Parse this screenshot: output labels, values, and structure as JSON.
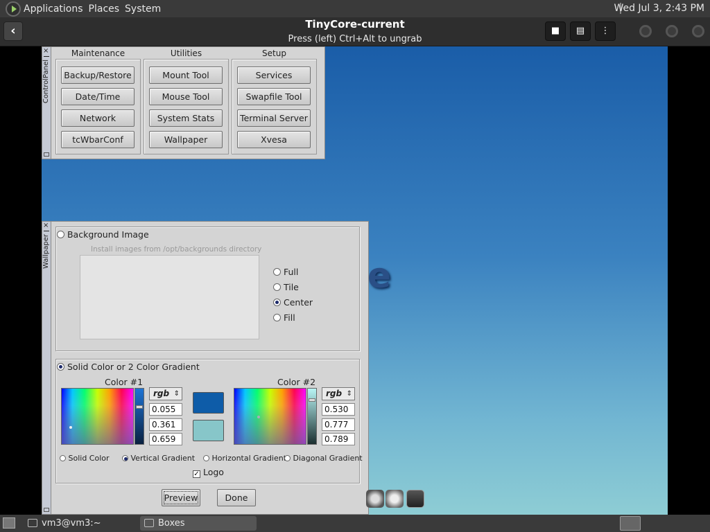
{
  "top_panel": {
    "menus": [
      "Applications",
      "Places",
      "System"
    ],
    "clock": "Wed Jul  3,  2:43 PM"
  },
  "header": {
    "title": "TinyCore-current",
    "subtitle": "Press (left) Ctrl+Alt to ungrab",
    "back_icon": "back-arrow-icon",
    "buttons": [
      "stop-icon",
      "screenshot-icon",
      "menu-icon"
    ]
  },
  "control_panel": {
    "window_title": "ControlPanel",
    "groups": [
      {
        "heading": "Maintenance",
        "buttons": [
          "Backup/Restore",
          "Date/Time",
          "Network",
          "tcWbarConf"
        ]
      },
      {
        "heading": "Utilities",
        "buttons": [
          "Mount Tool",
          "Mouse Tool",
          "System Stats",
          "Wallpaper"
        ]
      },
      {
        "heading": "Setup",
        "buttons": [
          "Services",
          "Swapfile Tool",
          "Terminal Server",
          "Xvesa"
        ]
      }
    ]
  },
  "wallpaper": {
    "window_title": "Wallpaper",
    "bg_image_label": "Background Image",
    "bg_image_hint": "Install images from /opt/backgrounds directory",
    "placement": [
      {
        "label": "Full",
        "selected": false
      },
      {
        "label": "Tile",
        "selected": false
      },
      {
        "label": "Center",
        "selected": true
      },
      {
        "label": "Fill",
        "selected": false
      }
    ],
    "solid_label": "Solid Color or 2 Color Gradient",
    "color1": {
      "label": "Color #1",
      "mode": "rgb",
      "values": [
        "0.055",
        "0.361",
        "0.659"
      ],
      "hex": "#0e5ca8"
    },
    "color2": {
      "label": "Color #2",
      "mode": "rgb",
      "values": [
        "0.530",
        "0.777",
        "0.789"
      ],
      "hex": "#87c6c9"
    },
    "gradient_types": [
      {
        "label": "Solid Color",
        "selected": false
      },
      {
        "label": "Vertical Gradient",
        "selected": true
      },
      {
        "label": "Horizontal Gradient",
        "selected": false
      },
      {
        "label": "Diagonal Gradient",
        "selected": false
      }
    ],
    "logo_label": "Logo",
    "logo_checked": true,
    "preview_label": "Preview",
    "done_label": "Done"
  },
  "logo_fragment": "e",
  "bottom_panel": {
    "tasks": [
      {
        "label": "vm3@vm3:~",
        "active": false
      },
      {
        "label": "Boxes",
        "active": true
      }
    ]
  }
}
